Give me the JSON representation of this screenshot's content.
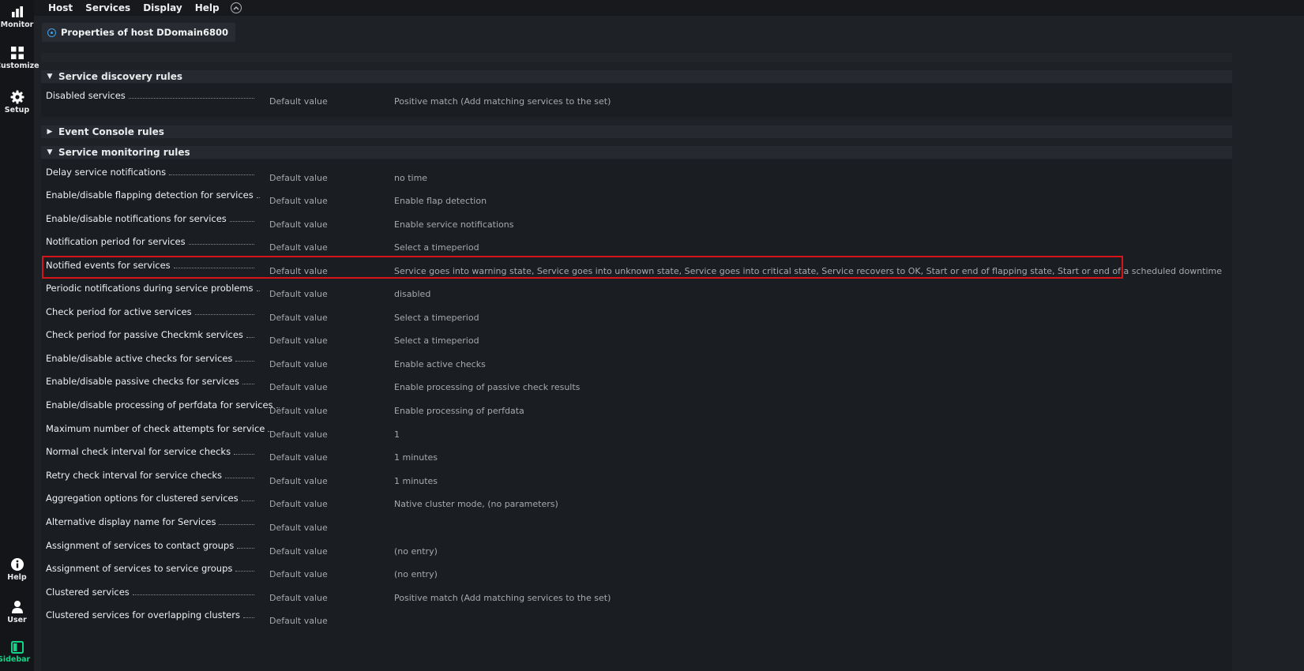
{
  "sidebar": {
    "items": [
      {
        "label": "Monitor",
        "icon": "bar-chart-icon"
      },
      {
        "label": "Customize",
        "icon": "grid-icon"
      },
      {
        "label": "Setup",
        "icon": "gear-icon"
      }
    ],
    "bottom_items": [
      {
        "label": "Help",
        "icon": "info-icon"
      },
      {
        "label": "User",
        "icon": "user-icon"
      },
      {
        "label": "Sidebar",
        "icon": "sidebar-icon"
      }
    ],
    "accent_color": "#13d389"
  },
  "menubar": {
    "items": [
      "Host",
      "Services",
      "Display",
      "Help"
    ]
  },
  "page": {
    "title": "Properties of host DDomain6800"
  },
  "sections": {
    "discovery": {
      "title": "Service discovery rules",
      "rows": [
        {
          "label": "Disabled services",
          "source": "Default value",
          "value": "Positive match (Add matching services to the set)"
        }
      ]
    },
    "event_console": {
      "title": "Event Console rules"
    },
    "monitoring": {
      "title": "Service monitoring rules",
      "rows": [
        {
          "label": "Delay service notifications",
          "source": "Default value",
          "value": "no time"
        },
        {
          "label": "Enable/disable flapping detection for services",
          "source": "Default value",
          "value": "Enable flap detection"
        },
        {
          "label": "Enable/disable notifications for services",
          "source": "Default value",
          "value": "Enable service notifications"
        },
        {
          "label": "Notification period for services",
          "source": "Default value",
          "value": "Select a timeperiod"
        },
        {
          "label": "Notified events for services",
          "source": "Default value",
          "value": "Service goes into warning state, Service goes into unknown state, Service goes into critical state, Service recovers to OK, Start or end of flapping state, Start or end of a scheduled downtime"
        },
        {
          "label": "Periodic notifications during service problems",
          "source": "Default value",
          "value": "disabled"
        },
        {
          "label": "Check period for active services",
          "source": "Default value",
          "value": "Select a timeperiod"
        },
        {
          "label": "Check period for passive Checkmk services",
          "source": "Default value",
          "value": "Select a timeperiod"
        },
        {
          "label": "Enable/disable active checks for services",
          "source": "Default value",
          "value": "Enable active checks"
        },
        {
          "label": "Enable/disable passive checks for services",
          "source": "Default value",
          "value": "Enable processing of passive check results"
        },
        {
          "label": "Enable/disable processing of perfdata for services",
          "source": "Default value",
          "value": "Enable processing of perfdata"
        },
        {
          "label": "Maximum number of check attempts for service",
          "source": "Default value",
          "value": "1"
        },
        {
          "label": "Normal check interval for service checks",
          "source": "Default value",
          "value": "1 minutes"
        },
        {
          "label": "Retry check interval for service checks",
          "source": "Default value",
          "value": "1 minutes"
        },
        {
          "label": "Aggregation options for clustered services",
          "source": "Default value",
          "value": "Native cluster mode, (no parameters)"
        },
        {
          "label": "Alternative display name for Services",
          "source": "Default value",
          "value": ""
        },
        {
          "label": "Assignment of services to contact groups",
          "source": "Default value",
          "value": "(no entry)"
        },
        {
          "label": "Assignment of services to service groups",
          "source": "Default value",
          "value": "(no entry)"
        },
        {
          "label": "Clustered services",
          "source": "Default value",
          "value": "Positive match (Add matching services to the set)"
        },
        {
          "label": "Clustered services for overlapping clusters",
          "source": "Default value",
          "value": ""
        }
      ]
    }
  }
}
